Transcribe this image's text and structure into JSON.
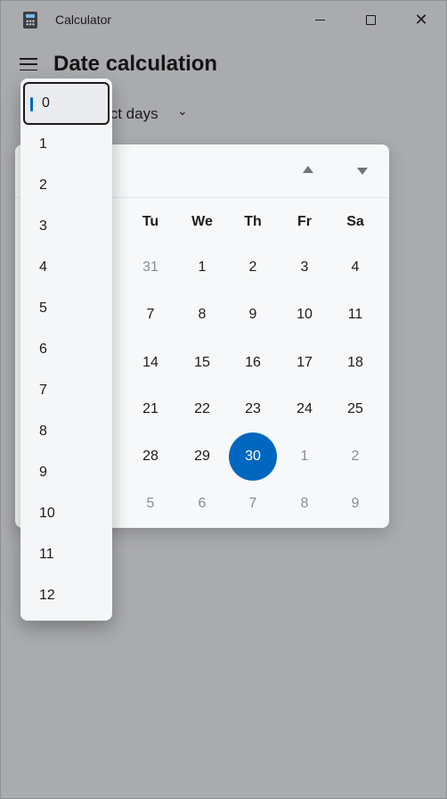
{
  "window": {
    "title": "Calculator",
    "icon": "calculator-icon"
  },
  "header": {
    "menu_icon": "hamburger-icon",
    "title": "Date calculation",
    "mode_partial": "ıct days"
  },
  "calendar": {
    "nav_up_icon": "caret-up-icon",
    "nav_down_icon": "caret-down-icon",
    "weekdays": [
      "Tu",
      "We",
      "Th",
      "Fr",
      "Sa"
    ],
    "weeks": [
      [
        "31",
        "1",
        "2",
        "3",
        "4"
      ],
      [
        "7",
        "8",
        "9",
        "10",
        "11"
      ],
      [
        "14",
        "15",
        "16",
        "17",
        "18"
      ],
      [
        "21",
        "22",
        "23",
        "24",
        "25"
      ],
      [
        "28",
        "29",
        "30",
        "1",
        "2"
      ],
      [
        "5",
        "6",
        "7",
        "8",
        "9"
      ]
    ],
    "selected_day": "30"
  },
  "dropdown": {
    "selected": "0",
    "options": [
      "0",
      "1",
      "2",
      "3",
      "4",
      "5",
      "6",
      "7",
      "8",
      "9",
      "10",
      "11",
      "12"
    ]
  },
  "colors": {
    "accent": "#0067c0",
    "overlay_bg": "#a9abae",
    "panel_bg": "#f6f8fa"
  }
}
